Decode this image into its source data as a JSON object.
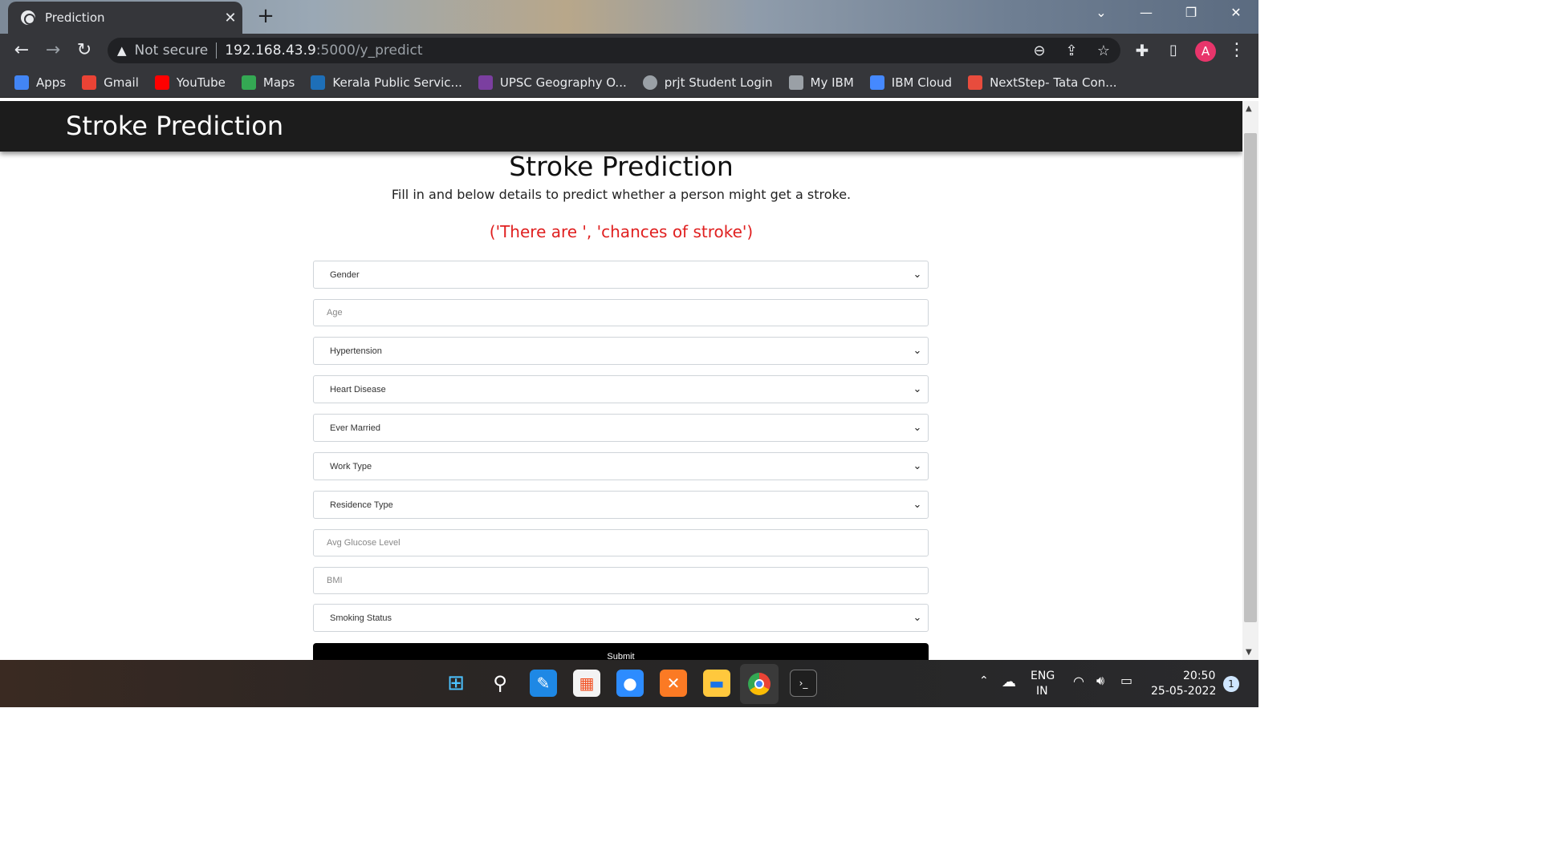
{
  "browser": {
    "tab_title": "Prediction",
    "tab_close": "✕",
    "new_tab": "+",
    "window_controls": [
      "⌄",
      "—",
      "❐",
      "✕"
    ],
    "not_secure": "Not secure",
    "url_host": "192.168.43.9",
    "url_path": ":5000/y_predict",
    "profile_initial": "A",
    "bookmarks": [
      {
        "label": "Apps",
        "color": "#4285f4"
      },
      {
        "label": "Gmail",
        "color": "#ea4335"
      },
      {
        "label": "YouTube",
        "color": "#ff0000"
      },
      {
        "label": "Maps",
        "color": "#34a853"
      },
      {
        "label": "Kerala Public Servic...",
        "color": "#1e6fb8"
      },
      {
        "label": "UPSC Geography O...",
        "color": "#7b3fa0"
      },
      {
        "label": "prjt Student Login",
        "color": "#9aa0a6"
      },
      {
        "label": "My IBM",
        "color": "#9aa0a6"
      },
      {
        "label": "IBM Cloud",
        "color": "#4589ff"
      },
      {
        "label": "NextStep- Tata Con...",
        "color": "#e84c3d"
      }
    ]
  },
  "page": {
    "navbar_brand": "Stroke Prediction",
    "heading": "Stroke Prediction",
    "subheading": "Fill in and below details to predict whether a person might get a stroke.",
    "result_text": "('There are ', 'chances of stroke')",
    "fields": {
      "gender": "Gender",
      "age": "Age",
      "hypertension": "Hypertension",
      "heart_disease": "Heart Disease",
      "ever_married": "Ever Married",
      "work_type": "Work Type",
      "residence_type": "Residence Type",
      "avg_glucose": "Avg Glucose Level",
      "bmi": "BMI",
      "smoking_status": "Smoking Status"
    },
    "submit_label": "Submit"
  },
  "taskbar": {
    "lang_top": "ENG",
    "lang_bottom": "IN",
    "time": "20:50",
    "date": "25-05-2022",
    "notifications": "1"
  }
}
